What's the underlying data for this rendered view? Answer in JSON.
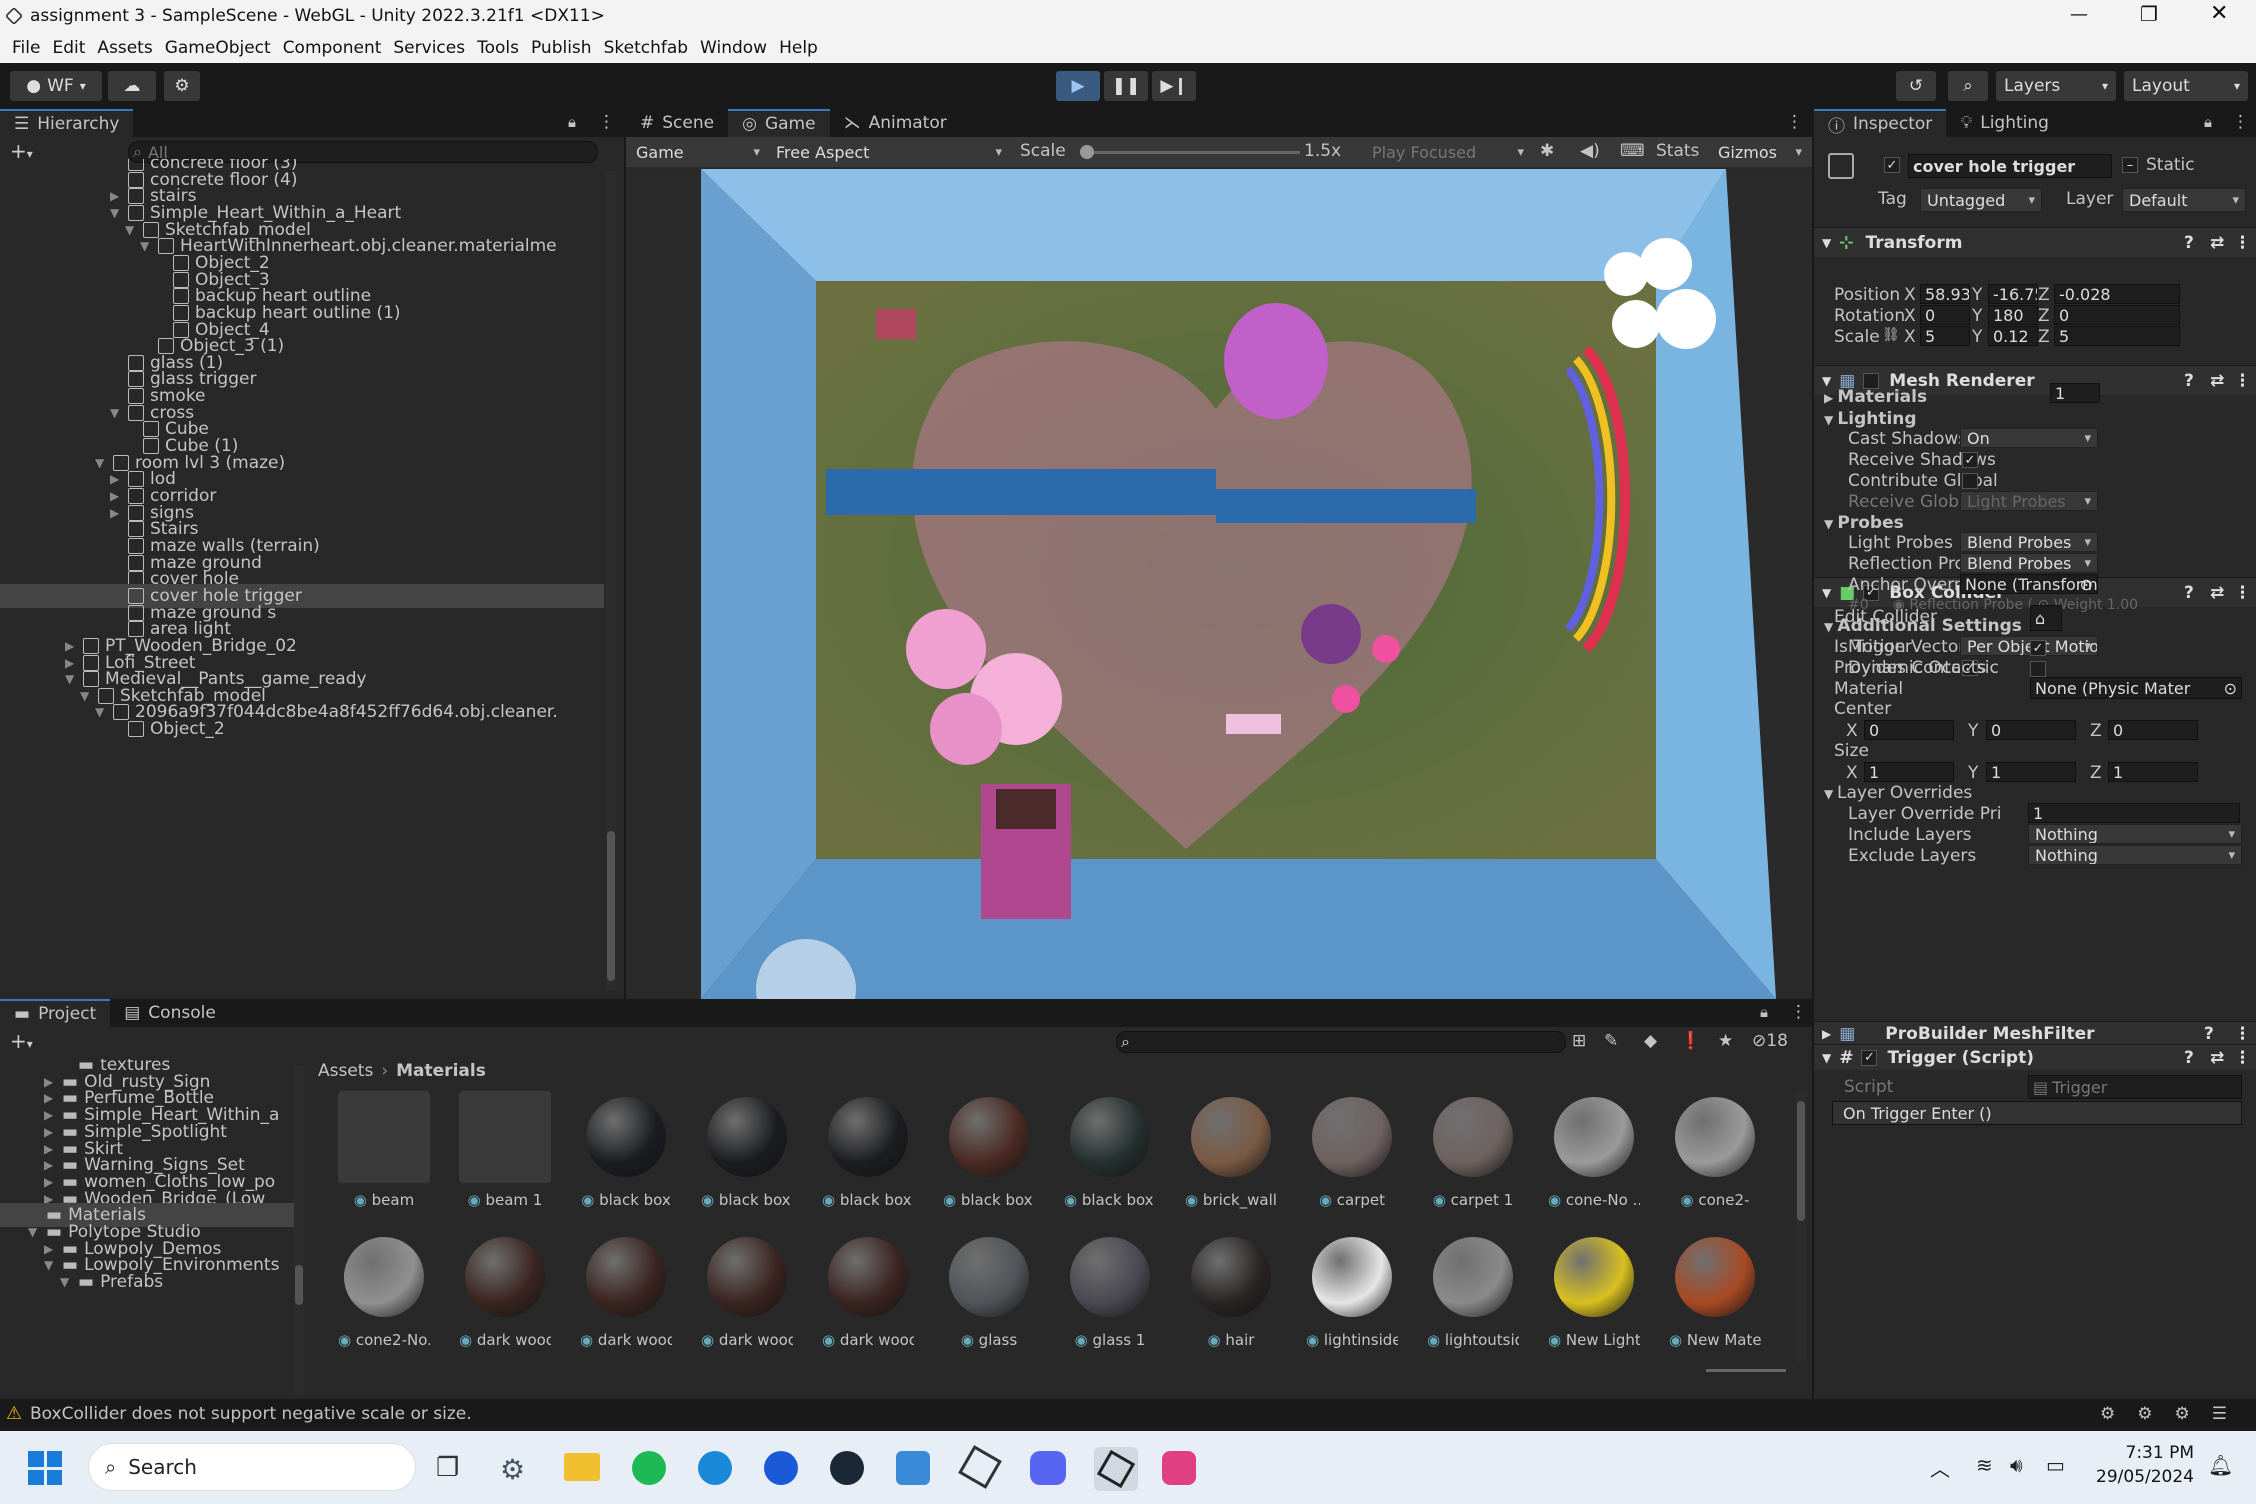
{
  "window": {
    "title": "assignment 3 - SampleScene - WebGL - Unity 2022.3.21f1 <DX11>"
  },
  "menu": [
    "File",
    "Edit",
    "Assets",
    "GameObject",
    "Component",
    "Services",
    "Tools",
    "Publish",
    "Sketchfab",
    "Window",
    "Help"
  ],
  "toolbar": {
    "account": "WF",
    "layers": "Layers",
    "layout": "Layout"
  },
  "hierarchy": {
    "tab": "Hierarchy",
    "search_placeholder": "All",
    "items": [
      {
        "label": "concrete floor (3)",
        "indent": 6
      },
      {
        "label": "concrete floor (4)",
        "indent": 6
      },
      {
        "label": "stairs",
        "indent": 6,
        "exp": "▶"
      },
      {
        "label": "Simple_Heart_Within_a_Heart",
        "indent": 6,
        "exp": "▼"
      },
      {
        "label": "Sketchfab_model",
        "indent": 7,
        "exp": "▼"
      },
      {
        "label": "HeartWithInnerheart.obj.cleaner.materialme",
        "indent": 8,
        "exp": "▼"
      },
      {
        "label": "Object_2",
        "indent": 9
      },
      {
        "label": "Object_3",
        "indent": 9
      },
      {
        "label": "backup heart outline",
        "indent": 9
      },
      {
        "label": "backup heart outline (1)",
        "indent": 9
      },
      {
        "label": "Object_4",
        "indent": 9
      },
      {
        "label": "Object_3 (1)",
        "indent": 8
      },
      {
        "label": "glass (1)",
        "indent": 6
      },
      {
        "label": "glass trigger",
        "indent": 6
      },
      {
        "label": "smoke",
        "indent": 6
      },
      {
        "label": "cross",
        "indent": 6,
        "exp": "▼"
      },
      {
        "label": "Cube",
        "indent": 7
      },
      {
        "label": "Cube (1)",
        "indent": 7
      },
      {
        "label": "room lvl 3 (maze)",
        "indent": 5,
        "exp": "▼"
      },
      {
        "label": "lod",
        "indent": 6,
        "exp": "▶"
      },
      {
        "label": "corridor",
        "indent": 6,
        "exp": "▶"
      },
      {
        "label": "signs",
        "indent": 6,
        "exp": "▶"
      },
      {
        "label": "Stairs",
        "indent": 6
      },
      {
        "label": "maze walls (terrain)",
        "indent": 6
      },
      {
        "label": "maze ground",
        "indent": 6
      },
      {
        "label": "cover hole",
        "indent": 6
      },
      {
        "label": "cover hole trigger",
        "indent": 6,
        "selected": true
      },
      {
        "label": "maze ground s",
        "indent": 6
      },
      {
        "label": "area light",
        "indent": 6
      },
      {
        "label": "PT_Wooden_Bridge_02",
        "indent": 3,
        "exp": "▶"
      },
      {
        "label": "Lofi_Street",
        "indent": 3,
        "exp": "▶"
      },
      {
        "label": "Medieval__Pants__game_ready",
        "indent": 3,
        "exp": "▼"
      },
      {
        "label": "Sketchfab_model",
        "indent": 4,
        "exp": "▼"
      },
      {
        "label": "2096a9f37f044dc8be4a8f452ff76d64.obj.cleaner.",
        "indent": 5,
        "exp": "▼"
      },
      {
        "label": "Object_2",
        "indent": 6
      }
    ]
  },
  "game": {
    "tabs": [
      "Scene",
      "Game",
      "Animator"
    ],
    "display": "Game",
    "aspect": "Free Aspect",
    "scale_label": "Scale",
    "scale_value": "1.5x",
    "play_focused": "Play Focused",
    "stats": "Stats",
    "gizmos": "Gizmos"
  },
  "inspector": {
    "tabs": [
      "Inspector",
      "Lighting"
    ],
    "object_name": "cover hole trigger",
    "static": "Static",
    "tag_label": "Tag",
    "tag": "Untagged",
    "layer_label": "Layer",
    "layer": "Default",
    "transform": {
      "title": "Transform",
      "position": {
        "label": "Position",
        "x": "58.933",
        "y": "-16.75",
        "z": "-0.028"
      },
      "rotation": {
        "label": "Rotation",
        "x": "0",
        "y": "180",
        "z": "0"
      },
      "scale": {
        "label": "Scale",
        "x": "5",
        "y": "0.12",
        "z": "5"
      }
    },
    "mesh_renderer": {
      "title": "Mesh Renderer",
      "materials": "Materials",
      "materials_count": "1",
      "lighting": "Lighting",
      "cast_shadows": "Cast Shadows",
      "cast_shadows_val": "On",
      "receive_shadows": "Receive Shadows",
      "contribute_gi": "Contribute Global",
      "receive_gi": "Receive Global Ill",
      "receive_gi_val": "Light Probes",
      "probes": "Probes",
      "light_probes": "Light Probes",
      "light_probes_val": "Blend Probes",
      "reflection_probes": "Reflection Probes",
      "reflection_probes_val": "Blend Probes",
      "anchor_override": "Anchor Override",
      "anchor_val": "None (Transform)",
      "probe_idx": "#0",
      "probe_name": "Reflection Probe (",
      "weight": "Weight 1.00",
      "additional": "Additional Settings",
      "motion_vectors": "Motion Vectors",
      "motion_vectors_val": "Per Object Motion",
      "dynamic_occ": "Dynamic Occlusic"
    },
    "box_collider": {
      "title": "Box Collider",
      "edit_collider": "Edit Collider",
      "is_trigger": "Is Trigger",
      "provides_contacts": "Provides Contacts",
      "material": "Material",
      "material_val": "None (Physic Mater",
      "center": "Center",
      "cx": "0",
      "cy": "0",
      "cz": "0",
      "size": "Size",
      "sx": "1",
      "sy": "1",
      "sz": "1",
      "layer_overrides": "Layer Overrides",
      "layer_priority": "Layer Override Pri",
      "layer_priority_val": "1",
      "include_layers": "Include Layers",
      "include_val": "Nothing",
      "exclude_layers": "Exclude Layers",
      "exclude_val": "Nothing"
    },
    "probuilder": "ProBuilder MeshFilter",
    "trigger": {
      "title": "Trigger (Script)",
      "script": "Script",
      "script_val": "Trigger",
      "event": "On Trigger Enter ()"
    }
  },
  "project": {
    "tabs": [
      "Project",
      "Console"
    ],
    "badge": "18",
    "tree": [
      {
        "label": "textures",
        "indent": 3
      },
      {
        "label": "Old_rusty_Sign",
        "indent": 2,
        "exp": "▶"
      },
      {
        "label": "Perfume_Bottle",
        "indent": 2,
        "exp": "▶"
      },
      {
        "label": "Simple_Heart_Within_a",
        "indent": 2,
        "exp": "▶"
      },
      {
        "label": "Simple_Spotlight",
        "indent": 2,
        "exp": "▶"
      },
      {
        "label": "Skirt",
        "indent": 2,
        "exp": "▶"
      },
      {
        "label": "Warning_Signs_Set",
        "indent": 2,
        "exp": "▶"
      },
      {
        "label": "women_Cloths_low_po",
        "indent": 2,
        "exp": "▶"
      },
      {
        "label": "Wooden_Bridge_(Low_",
        "indent": 2,
        "exp": "▶"
      },
      {
        "label": "Materials",
        "indent": 1,
        "selected": true
      },
      {
        "label": "Polytope Studio",
        "indent": 1,
        "exp": "▼"
      },
      {
        "label": "Lowpoly_Demos",
        "indent": 2,
        "exp": "▶"
      },
      {
        "label": "Lowpoly_Environments",
        "indent": 2,
        "exp": "▼"
      },
      {
        "label": "Prefabs",
        "indent": 3,
        "exp": "▼"
      }
    ],
    "breadcrumb": [
      "Assets",
      "Materials"
    ],
    "materials": [
      {
        "name": "beam",
        "color": "#3a3a3a",
        "flat": true
      },
      {
        "name": "beam 1",
        "color": "#3a3a3a",
        "flat": true
      },
      {
        "name": "black box",
        "color": "#1a1c20"
      },
      {
        "name": "black box 1",
        "color": "#1a1c20"
      },
      {
        "name": "black box 2",
        "color": "#1c1d20"
      },
      {
        "name": "black box 3",
        "color": "#4a2a22"
      },
      {
        "name": "black box 4",
        "color": "#24302e"
      },
      {
        "name": "brick_wall",
        "color": "#7a5a44"
      },
      {
        "name": "carpet",
        "color": "#6e6260"
      },
      {
        "name": "carpet 1",
        "color": "#6e6260"
      },
      {
        "name": "cone-No ...",
        "color": "#9a9a9a"
      },
      {
        "name": "cone2-",
        "color": "#9a9a9a"
      },
      {
        "name": "cone2-No...",
        "color": "#909090"
      },
      {
        "name": "dark wood",
        "color": "#3a2420"
      },
      {
        "name": "dark wood 1",
        "color": "#3a2420"
      },
      {
        "name": "dark wood...",
        "color": "#3a2420"
      },
      {
        "name": "dark wood...",
        "color": "#3a2420"
      },
      {
        "name": "glass",
        "color": "#505458"
      },
      {
        "name": "glass 1",
        "color": "#4a4850"
      },
      {
        "name": "hair",
        "color": "#2a2424"
      },
      {
        "name": "lightinside",
        "color": "#e6e6e6"
      },
      {
        "name": "lightoutside",
        "color": "#8a8a8a"
      },
      {
        "name": "New Lighti...",
        "color": "#d8c020"
      },
      {
        "name": "New Mater...",
        "color": "#a84a24"
      }
    ]
  },
  "status": {
    "warning": "BoxCollider does not support negative scale or size."
  },
  "taskbar": {
    "search": "Search",
    "time": "7:31 PM",
    "date": "29/05/2024"
  }
}
